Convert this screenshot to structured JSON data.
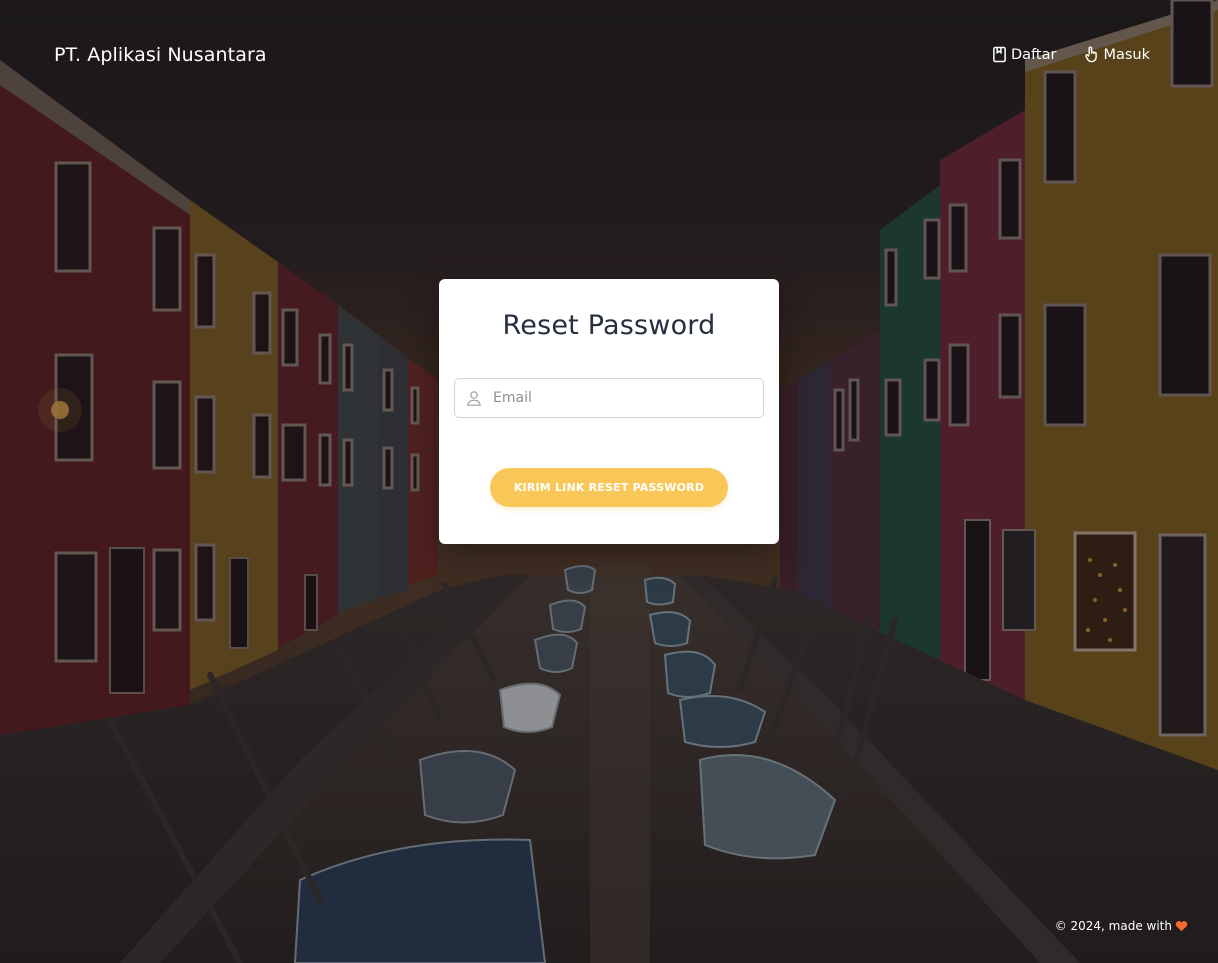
{
  "brand": {
    "name": "PT. Aplikasi Nusantara"
  },
  "nav": {
    "items": [
      {
        "label": "Daftar",
        "icon": "book-icon"
      },
      {
        "label": "Masuk",
        "icon": "hand-pointer-icon"
      }
    ]
  },
  "form": {
    "title": "Reset Password",
    "email_placeholder": "Email",
    "email_value": "",
    "email_icon": "user-icon",
    "submit_label": "Kirim Link Reset Password"
  },
  "footer": {
    "text": "© 2024, made with",
    "icon": "heart-icon"
  },
  "colors": {
    "accent": "#f9c758",
    "heart": "#f26b2e",
    "title_text": "#252f40",
    "overlay": "#1c181c"
  }
}
